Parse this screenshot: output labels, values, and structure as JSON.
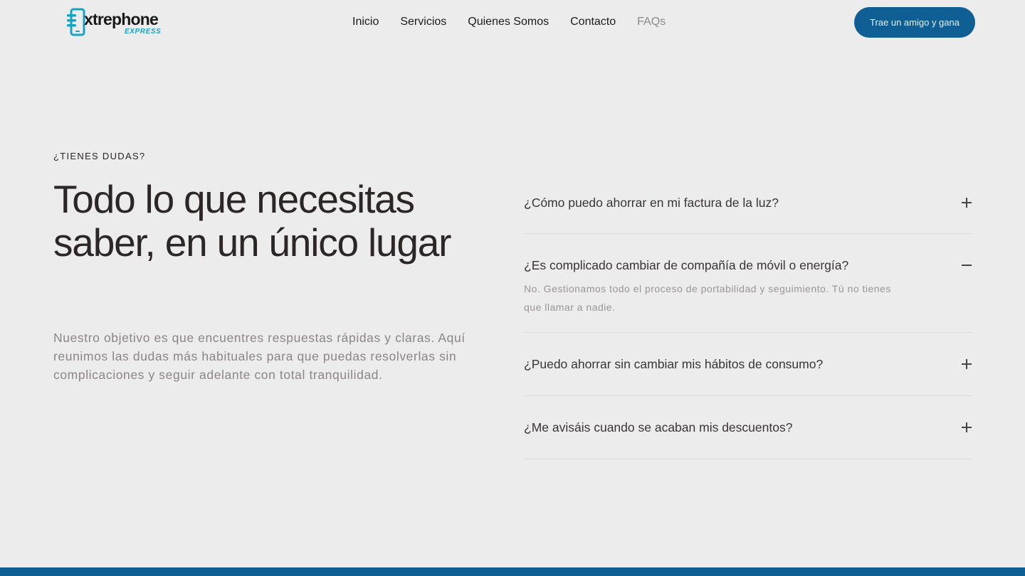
{
  "header": {
    "logo": {
      "brand": "xtrephone",
      "sub": "EXPRESS"
    },
    "nav": [
      {
        "label": "Inicio",
        "active": false
      },
      {
        "label": "Servicios",
        "active": false
      },
      {
        "label": "Quienes Somos",
        "active": false
      },
      {
        "label": "Contacto",
        "active": false
      },
      {
        "label": "FAQs",
        "active": true
      }
    ],
    "cta_label": "Trae un amigo y gana"
  },
  "hero": {
    "eyebrow": "¿TIENES DUDAS?",
    "title": "Todo lo que necesitas saber, en un único lugar",
    "intro": "Nuestro objetivo es que encuentres respuestas rápidas y claras. Aquí reunimos las dudas más habituales para que puedas resolverlas sin complicaciones y seguir adelante con total tranquilidad."
  },
  "faq": [
    {
      "question": "¿Cómo puedo ahorrar en mi factura de la luz?",
      "expanded": false,
      "icon": "plus-icon"
    },
    {
      "question": "¿Es complicado cambiar de compañía de móvil o energía?",
      "expanded": true,
      "icon": "minus-icon",
      "answer": "No. Gestionamos todo el proceso de portabilidad y seguimiento. Tú no tienes que llamar a nadie."
    },
    {
      "question": "¿Puedo ahorrar sin cambiar mis hábitos de consumo?",
      "expanded": false,
      "icon": "plus-icon"
    },
    {
      "question": "¿Me avisáis cuando se acaban mis descuentos?",
      "expanded": false,
      "icon": "plus-icon"
    }
  ],
  "colors": {
    "brand": "#0f5f95",
    "accent": "#17a4c4",
    "background": "#ececed"
  }
}
